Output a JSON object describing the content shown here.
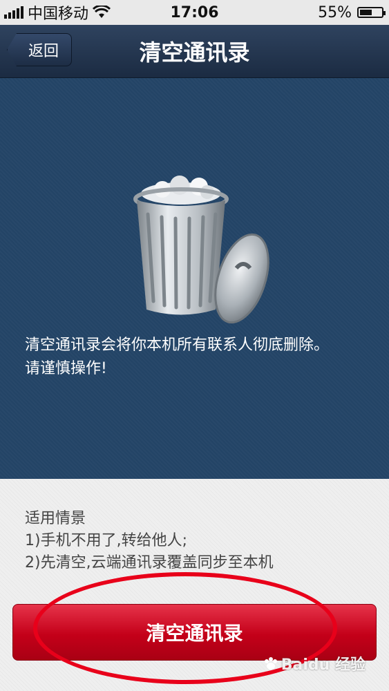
{
  "status_bar": {
    "carrier": "中国移动",
    "time": "17:06",
    "battery_percent": "55%",
    "battery_level": 0.55
  },
  "nav": {
    "back_label": "返回",
    "title": "清空通讯录"
  },
  "hero": {
    "icon": "trash-can-icon",
    "warning_line1": "清空通讯录会将你本机所有联系人彻底删除。",
    "warning_line2": "请谨慎操作!"
  },
  "info": {
    "heading": "适用情景",
    "item1": "1)手机不用了,转给他人;",
    "item2": "2)先清空,云端通讯录覆盖同步至本机"
  },
  "action": {
    "clear_label": "清空通讯录"
  },
  "watermark": {
    "text": "Baidu 经验"
  },
  "colors": {
    "nav_bg": "#1b2b42",
    "hero_bg": "#234466",
    "button_red": "#c40019",
    "annotation_red": "#e8001a"
  }
}
